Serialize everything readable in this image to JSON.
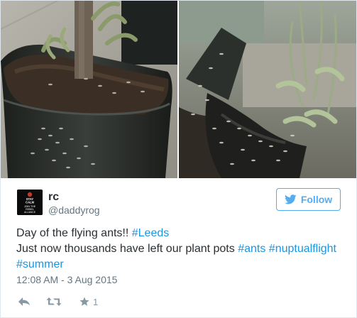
{
  "tweet": {
    "author": {
      "display_name": "rc",
      "handle": "@daddyrog",
      "avatar_lines": [
        "STAY",
        "CALM",
        "JOIN THE",
        "REBEL",
        "ALLIANCE"
      ]
    },
    "follow_label": "Follow",
    "text_lines": [
      [
        {
          "text": "Day of the flying ants!! ",
          "hashtag": false
        },
        {
          "text": "#Leeds",
          "hashtag": true
        }
      ],
      [
        {
          "text": "Just now thousands have left our plant pots ",
          "hashtag": false
        },
        {
          "text": "#ants",
          "hashtag": true
        },
        {
          "text": " ",
          "hashtag": false
        },
        {
          "text": "#nuptualflight",
          "hashtag": true
        }
      ],
      [
        {
          "text": "#summer",
          "hashtag": true
        }
      ]
    ],
    "timestamp": "12:08 AM - 3 Aug 2015",
    "actions": {
      "reply_icon": "reply-icon",
      "retweet_icon": "retweet-icon",
      "favorite_icon": "star-icon",
      "favorite_count": "1"
    }
  },
  "colors": {
    "link": "#1b95e0",
    "follow": "#55acee",
    "muted": "#66757f",
    "text": "#292f33",
    "border": "#e1e8ed"
  }
}
